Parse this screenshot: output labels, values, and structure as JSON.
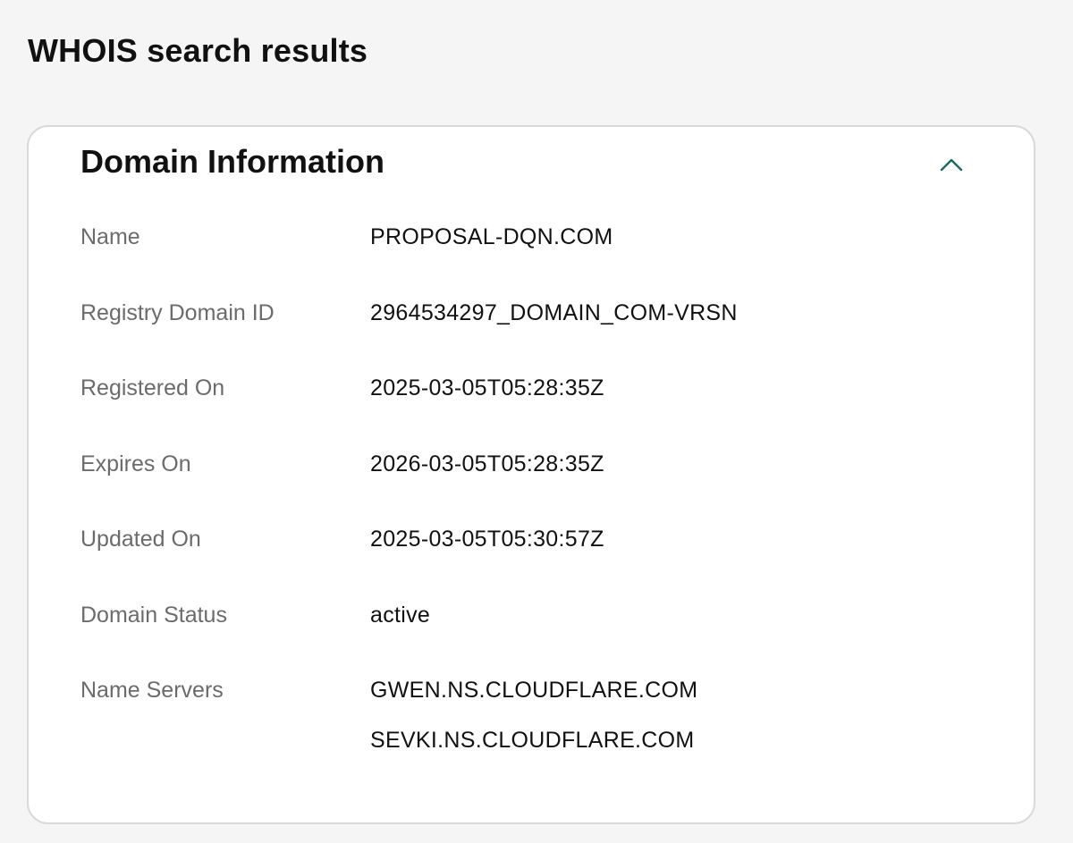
{
  "page": {
    "title": "WHOIS search results"
  },
  "domain_info": {
    "title": "Domain Information",
    "collapse_icon": "chevron-up-icon",
    "accent_color": "#1b6b63",
    "rows": [
      {
        "label": "Name",
        "value": "PROPOSAL-DQN.COM"
      },
      {
        "label": "Registry Domain ID",
        "value": "2964534297_DOMAIN_COM-VRSN"
      },
      {
        "label": "Registered On",
        "value": "2025-03-05T05:28:35Z"
      },
      {
        "label": "Expires On",
        "value": "2026-03-05T05:28:35Z"
      },
      {
        "label": "Updated On",
        "value": "2025-03-05T05:30:57Z"
      },
      {
        "label": "Domain Status",
        "value": "active"
      }
    ],
    "name_servers": {
      "label": "Name Servers",
      "values": [
        "GWEN.NS.CLOUDFLARE.COM",
        "SEVKI.NS.CLOUDFLARE.COM"
      ]
    }
  }
}
